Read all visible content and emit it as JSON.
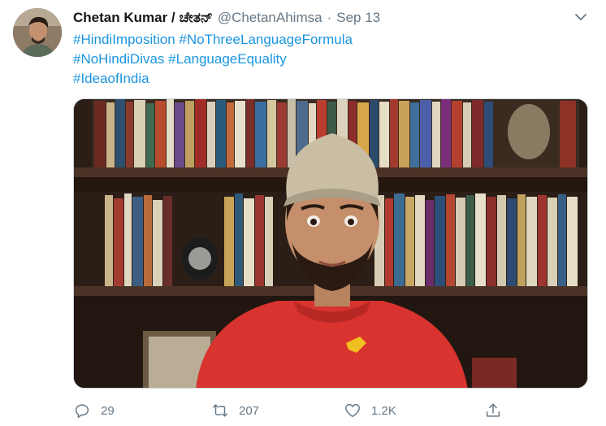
{
  "tweet": {
    "author_name": "Chetan Kumar /",
    "author_name_kannada": "ಚೇತನ್",
    "handle": "@ChetanAhimsa",
    "separator": "·",
    "timestamp": "Sep 13",
    "hashtags": [
      "#HindiImposition #NoThreeLanguageFormula",
      "#NoHindiDivas #LanguageEquality",
      "#IdeaofIndia"
    ]
  },
  "actions": {
    "reply_count": "29",
    "retweet_count": "207",
    "like_count": "1.2K"
  },
  "colors": {
    "link": "#1b95e0",
    "secondary_text": "#657786",
    "shirt": "#d8332e"
  }
}
